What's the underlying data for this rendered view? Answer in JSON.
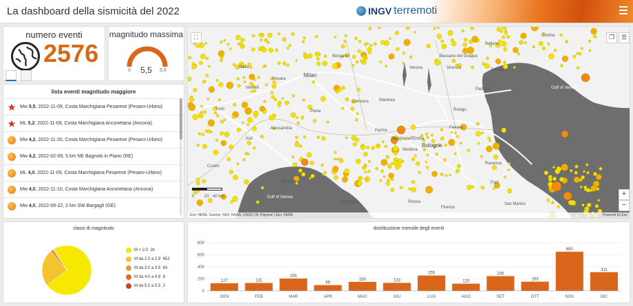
{
  "header": {
    "title": "La dashboard della sismicità del 2022",
    "logo_ingv": "INGV",
    "logo_terremoti": "terremoti"
  },
  "count_panel": {
    "label": "numero eventi",
    "value": "2576"
  },
  "magnitude_panel": {
    "label": "magnitudo massima",
    "value": "5,5",
    "min": "0",
    "max": "5,5",
    "fraction": 1.0
  },
  "event_list": {
    "title": "lista eventi magnitudo maggiore",
    "items": [
      {
        "icon": "star-icon",
        "type": "Mw",
        "mag": "5,5",
        "rest": ", 2022-11-09,  Costa Marchigiana Pesarese (Pesaro-Urbino)"
      },
      {
        "icon": "star-icon",
        "type": "ML",
        "mag": "5,2",
        "rest": ", 2022-11-09,  Costa Marchigiana Anconetana (Ancona)"
      },
      {
        "icon": "dot-icon",
        "type": "Mw",
        "mag": "4,2",
        "rest": ", 2022-11-20,  Costa Marchigiana Pesarese (Pesaro-Urbino)"
      },
      {
        "icon": "dot-icon",
        "type": "Mw",
        "mag": "4,2",
        "rest": ", 2022-02-09,  5 km NE Bagnolo in Piano (RE)"
      },
      {
        "icon": "dot-icon",
        "type": "ML",
        "mag": "4,0",
        "rest": ", 2022-11-09,  Costa Marchigiana Pesarese (Pesaro-Urbino)"
      },
      {
        "icon": "dot-icon",
        "type": "Mw",
        "mag": "4,0",
        "rest": ", 2022-11-10,  Costa Marchigiana Anconetana (Ancona)"
      },
      {
        "icon": "dot-icon",
        "type": "Mw",
        "mag": "4,0",
        "rest": ", 2022-09-22,  2 km SW Bargagli (GE)"
      }
    ]
  },
  "map": {
    "labels": {
      "bergamo": "Bergamo",
      "milan": "Milan",
      "torino": "Turin",
      "genova": "Genova",
      "parma": "Parma",
      "bologna": "Bologna",
      "ferrara": "Ferrara",
      "padova": "Padova",
      "vicenza": "Vicenza",
      "venice_gulf": "Gulf of Venice",
      "firenze": "Firenze",
      "pistoia": "Pistoia",
      "ravenna": "Ravenna",
      "san_marino": "San Marino",
      "verona": "Verona",
      "mantova": "Mantova",
      "gulf_genoa": "Gulf of Genoa",
      "novara": "Novara",
      "biella": "Biella",
      "vercelli": "Vercelli",
      "pavia": "Pavia",
      "asti": "Asti",
      "cuneo": "Cuneo",
      "alessandria": "Alessandria",
      "cremona": "Cremona",
      "reggio": "Reggio nell'Emilia",
      "modena": "Modena",
      "belluno": "Belluno",
      "treviso": "Treviso",
      "rovigo": "Rovigo",
      "la_spezia": "La Spezia",
      "forli": "Forli",
      "bassano": "Bassano del Grappa",
      "cortina": "Cortina"
    },
    "scale_label": "40 km",
    "scale_zero": "0",
    "scale_twenty": "20",
    "attribution": "Esri, HERE, Garmin, FAO, NOAA, USGS | M. Pignone | Esri, HERE",
    "powered": "Powered by Esri",
    "zoom_in": "+",
    "zoom_out": "−"
  },
  "pie_panel": {
    "title": "classi di magnitudo",
    "classes": [
      {
        "label": "M < 2.0",
        "count": "2k",
        "value": 2000,
        "color": "#f7e800"
      },
      {
        "label": "M da 2.0 a 2.9",
        "count": "652",
        "value": 652,
        "color": "#f4c430"
      },
      {
        "label": "M da 3.0 a 3.9",
        "count": "63",
        "value": 63,
        "color": "#e8964a"
      },
      {
        "label": "M da 4.0 a 4.9",
        "count": "6",
        "value": 6,
        "color": "#e06a1e"
      },
      {
        "label": "M da 5.0 a 5.5",
        "count": "2",
        "value": 2,
        "color": "#d0451b"
      }
    ]
  },
  "chart_data": {
    "type": "bar",
    "title": "distribuzione mensile degli eventi",
    "categories": [
      "GEN",
      "FEB",
      "MAR",
      "APR",
      "MAG",
      "GIU",
      "LUG",
      "AGO",
      "SET",
      "OTT",
      "NOV",
      "DIC"
    ],
    "values": [
      127,
      131,
      205,
      96,
      150,
      133,
      255,
      120,
      245,
      153,
      650,
      311
    ],
    "ylim": [
      0,
      800
    ],
    "yticks": [
      0,
      200,
      400,
      600,
      800
    ],
    "color": "#d9661a"
  },
  "colors": {
    "accent": "#d46a17",
    "bar": "#d9661a"
  }
}
